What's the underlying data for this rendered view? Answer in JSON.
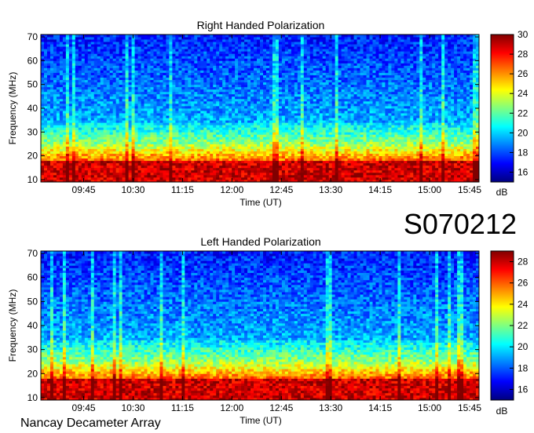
{
  "observation_code": "S070212",
  "footer": "Nancay Decameter Array",
  "chart_data": [
    {
      "type": "heatmap",
      "title": "Right Handed Polarization",
      "xlabel": "Time (UT)",
      "ylabel": "Frequency (MHz)",
      "x_ticks": [
        "09:45",
        "10:30",
        "11:15",
        "12:00",
        "12:45",
        "13:30",
        "14:15",
        "15:00",
        "15:45"
      ],
      "x_range": [
        "09:06",
        "15:45"
      ],
      "y_ticks": [
        10,
        20,
        30,
        40,
        50,
        60,
        70
      ],
      "ylim": [
        9,
        71
      ],
      "colorbar": {
        "label": "dB",
        "ticks": [
          16,
          18,
          20,
          22,
          24,
          26,
          28,
          30
        ],
        "range": [
          15,
          30
        ],
        "colormap": "jet"
      }
    },
    {
      "type": "heatmap",
      "title": "Left Handed Polarization",
      "xlabel": "Time (UT)",
      "ylabel": "Frequency (MHz)",
      "x_ticks": [
        "09:45",
        "10:30",
        "11:15",
        "12:00",
        "12:45",
        "13:30",
        "14:15",
        "15:00",
        "15:45"
      ],
      "x_range": [
        "09:06",
        "15:45"
      ],
      "y_ticks": [
        10,
        20,
        30,
        40,
        50,
        60,
        70
      ],
      "ylim": [
        9,
        71
      ],
      "colorbar": {
        "label": "dB",
        "ticks": [
          16,
          18,
          20,
          22,
          24,
          26,
          28
        ],
        "range": [
          15,
          29
        ],
        "colormap": "jet"
      }
    }
  ]
}
